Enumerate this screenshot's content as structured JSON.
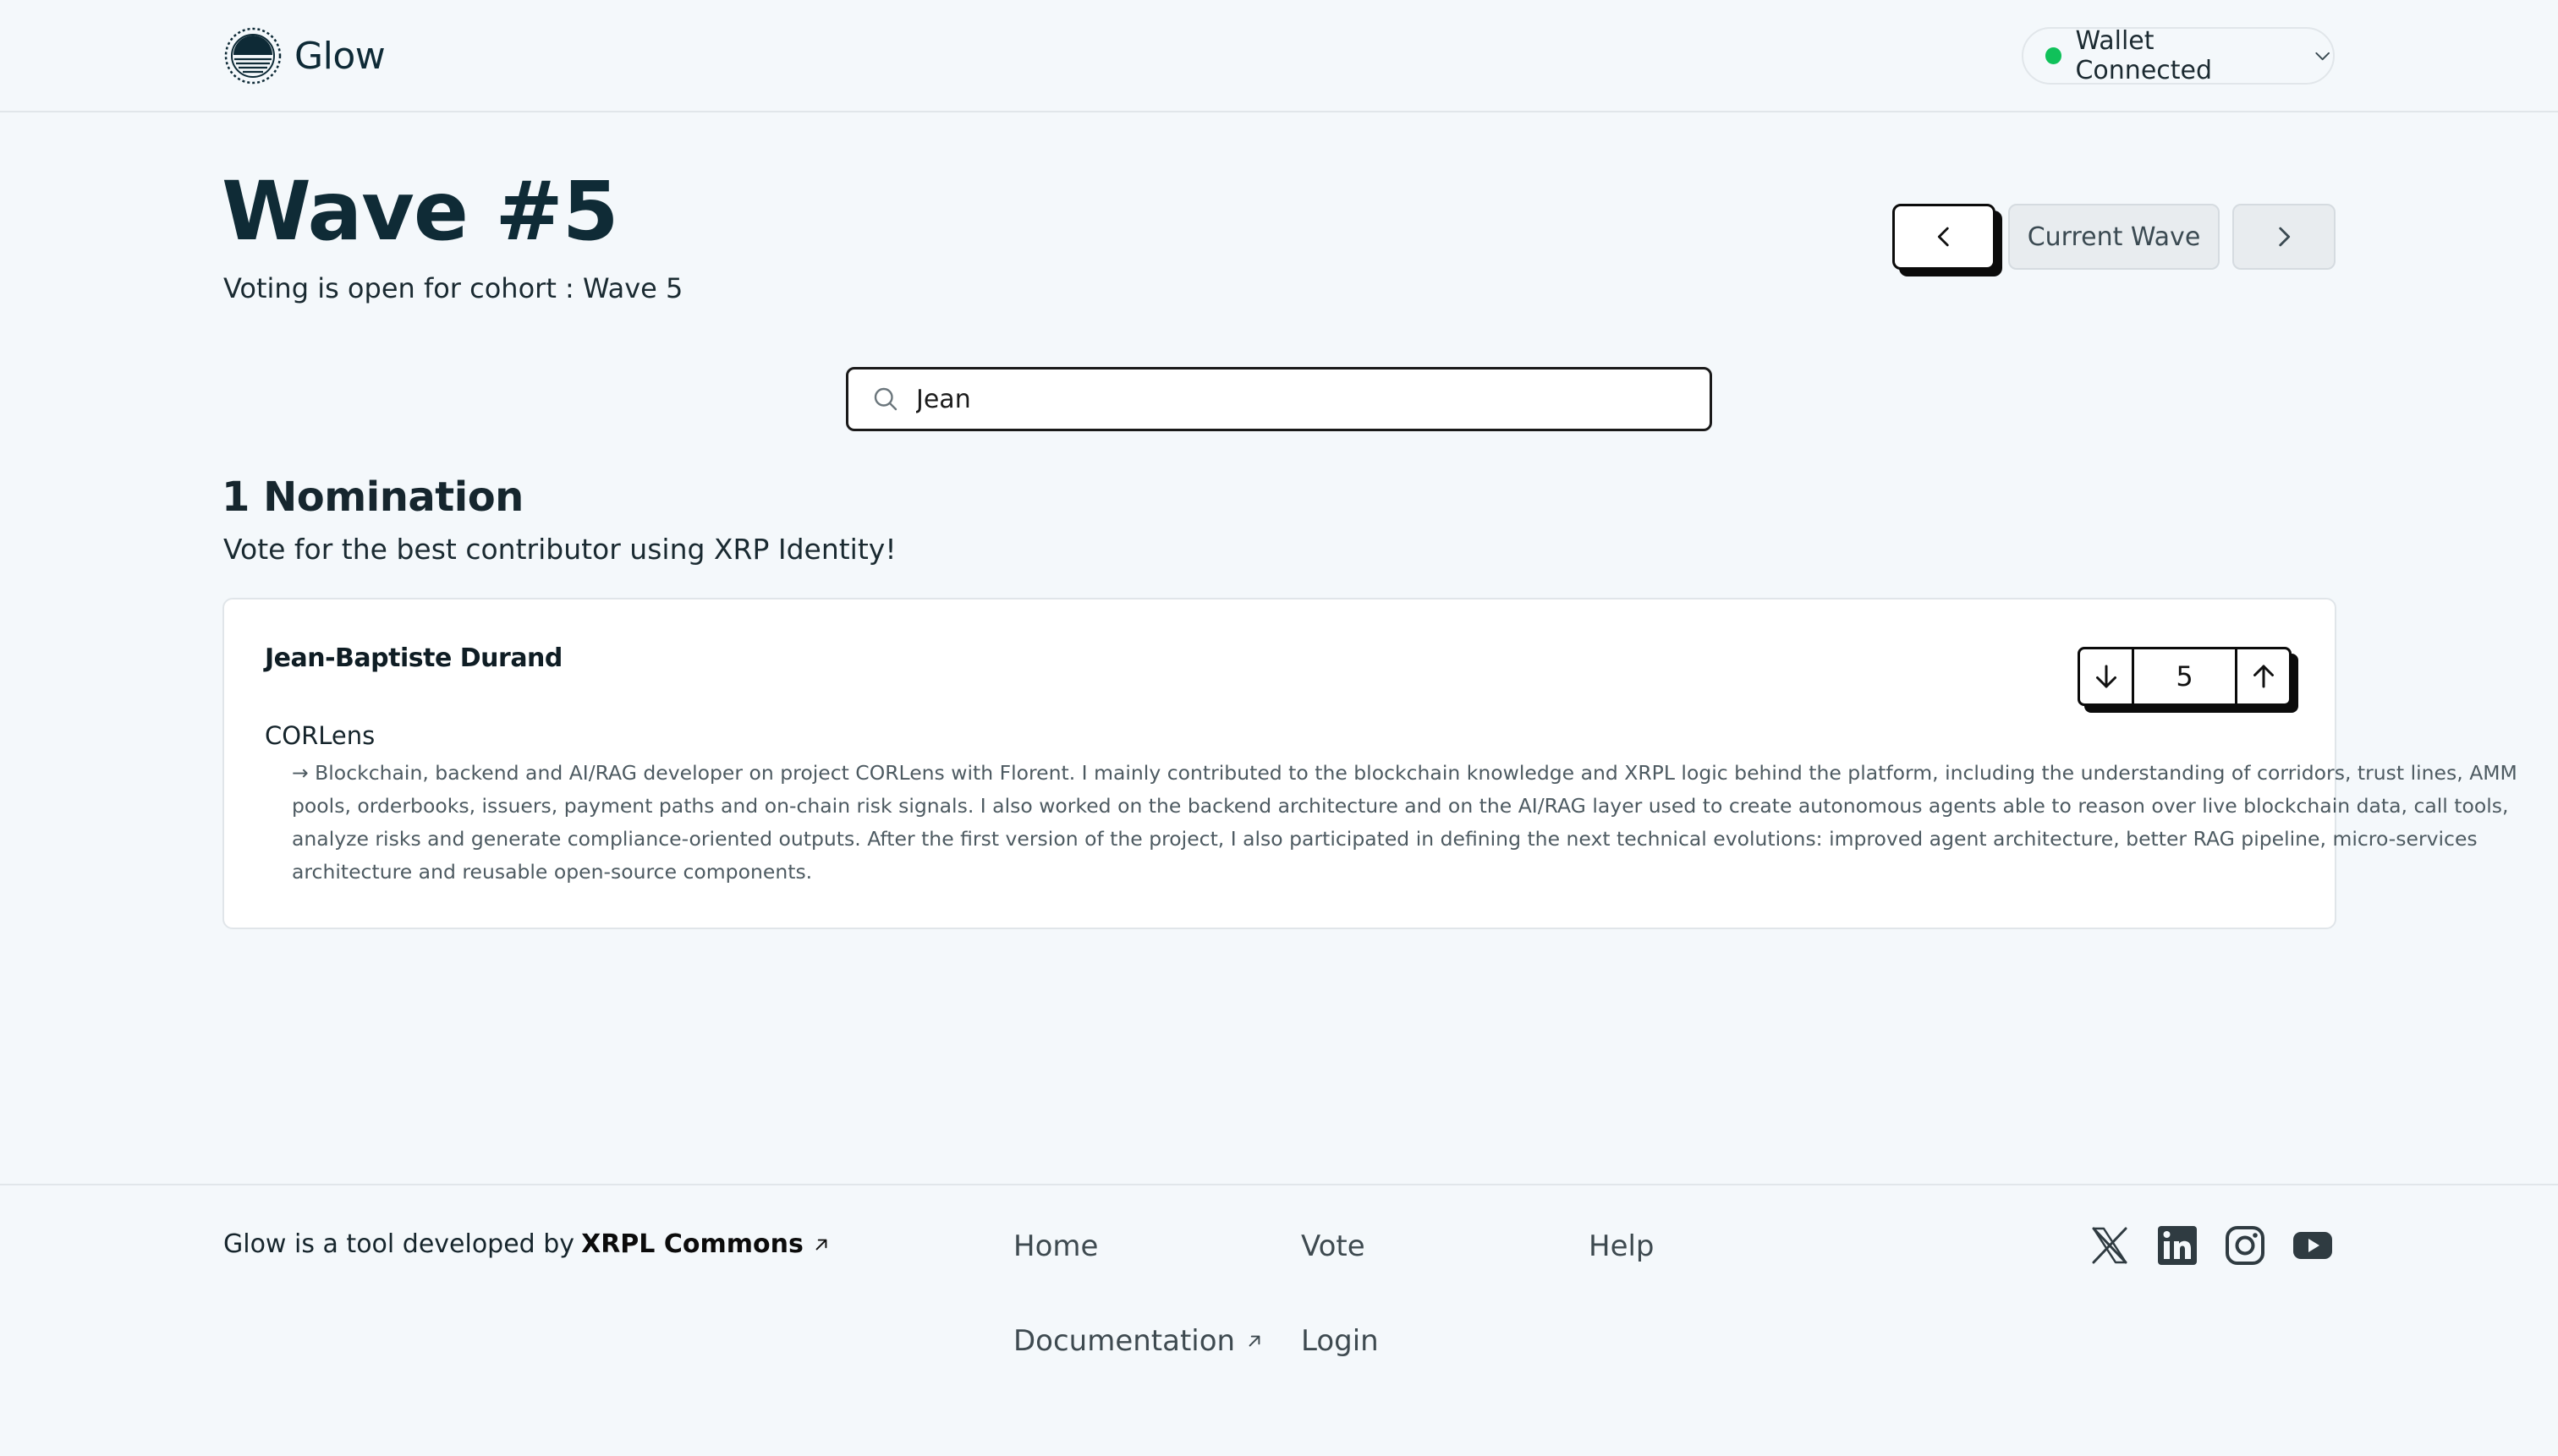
{
  "header": {
    "logo_text": "Glow",
    "wallet_label": "Wallet Connected",
    "wallet_status_color": "#10c15a"
  },
  "wave": {
    "title": "Wave #5",
    "subtitle": "Voting is open for cohort : Wave 5",
    "current_label": "Current Wave"
  },
  "search": {
    "value": "Jean",
    "icon": "search-icon"
  },
  "nominations": {
    "count_label": "1 Nomination",
    "subtitle": "Vote for the best contributor using XRP Identity!",
    "items": [
      {
        "name": "Jean-Baptiste Durand",
        "project": "CORLens",
        "description": "→ Blockchain, backend and AI/RAG developer on project CORLens with Florent. I mainly contributed to the blockchain knowledge and XRPL logic behind the platform, including the understanding of corridors, trust lines, AMM pools, orderbooks, issuers, payment paths and on-chain risk signals. I also worked on the backend architecture and on the AI/RAG layer used to create autonomous agents able to reason over live blockchain data, call tools, analyze risks and generate compliance-oriented outputs. After the first version of the project, I also participated in defining the next technical evolutions: improved agent architecture, better RAG pipeline, micro-services architecture and reusable open-source components.",
        "votes": "5"
      }
    ]
  },
  "footer": {
    "credit_prefix": "Glow is a tool developed by",
    "credit_org": "XRPL Commons",
    "links": {
      "home": "Home",
      "vote": "Vote",
      "help": "Help",
      "documentation": "Documentation",
      "login": "Login"
    },
    "social_icons": [
      "x-icon",
      "linkedin-icon",
      "instagram-icon",
      "youtube-icon"
    ]
  },
  "colors": {
    "background": "#f4f8fb",
    "title": "#0f2b36",
    "accent_black": "#0b0b0b"
  }
}
